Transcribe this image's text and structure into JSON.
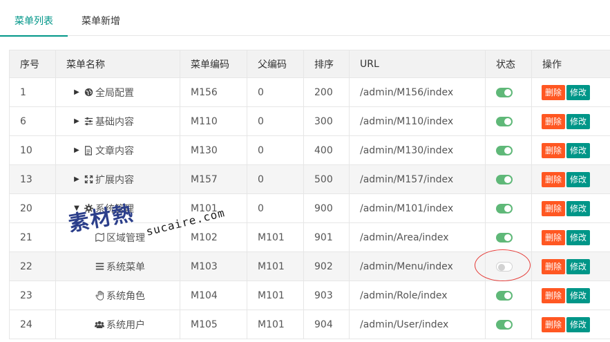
{
  "tabs": [
    {
      "label": "菜单列表",
      "active": true
    },
    {
      "label": "菜单新增",
      "active": false
    }
  ],
  "table": {
    "columns": [
      "序号",
      "菜单名称",
      "菜单编码",
      "父编码",
      "排序",
      "URL",
      "状态",
      "操作"
    ],
    "rows": [
      {
        "id": "1",
        "arrow": "right",
        "icon": "globe-icon",
        "name": "全局配置",
        "code": "M156",
        "parent": "0",
        "sort": "200",
        "url": "/admin/M156/index",
        "status": true
      },
      {
        "id": "6",
        "arrow": "right",
        "icon": "sliders-icon",
        "name": "基础内容",
        "code": "M110",
        "parent": "0",
        "sort": "300",
        "url": "/admin/M110/index",
        "status": true
      },
      {
        "id": "10",
        "arrow": "right",
        "icon": "document-icon",
        "name": "文章内容",
        "code": "M130",
        "parent": "0",
        "sort": "400",
        "url": "/admin/M130/index",
        "status": true
      },
      {
        "id": "13",
        "arrow": "right",
        "icon": "expand-icon",
        "name": "扩展内容",
        "code": "M157",
        "parent": "0",
        "sort": "500",
        "url": "/admin/M157/index",
        "status": true
      },
      {
        "id": "20",
        "arrow": "down",
        "icon": "gear-icon",
        "name": "系统管理",
        "code": "M101",
        "parent": "0",
        "sort": "900",
        "url": "/admin/M101/index",
        "status": true
      },
      {
        "id": "21",
        "arrow": "none",
        "icon": "map-icon",
        "name": "区域管理",
        "code": "M102",
        "parent": "M101",
        "sort": "901",
        "url": "/admin/Area/index",
        "status": true
      },
      {
        "id": "22",
        "arrow": "none",
        "icon": "list-icon",
        "name": "系统菜单",
        "code": "M103",
        "parent": "M101",
        "sort": "902",
        "url": "/admin/Menu/index",
        "status": false
      },
      {
        "id": "23",
        "arrow": "none",
        "icon": "hand-icon",
        "name": "系统角色",
        "code": "M104",
        "parent": "M101",
        "sort": "903",
        "url": "/admin/Role/index",
        "status": true
      },
      {
        "id": "24",
        "arrow": "none",
        "icon": "users-icon",
        "name": "系统用户",
        "code": "M105",
        "parent": "M101",
        "sort": "904",
        "url": "/admin/User/index",
        "status": true
      }
    ],
    "delete_label": "删除",
    "edit_label": "修改"
  },
  "watermark": {
    "cn": "素材熱",
    "en": "sucaire.com"
  },
  "colors": {
    "accent": "#009688",
    "switch_on": "#5fb878",
    "delete": "#ff5722",
    "highlight": "#e53935"
  }
}
